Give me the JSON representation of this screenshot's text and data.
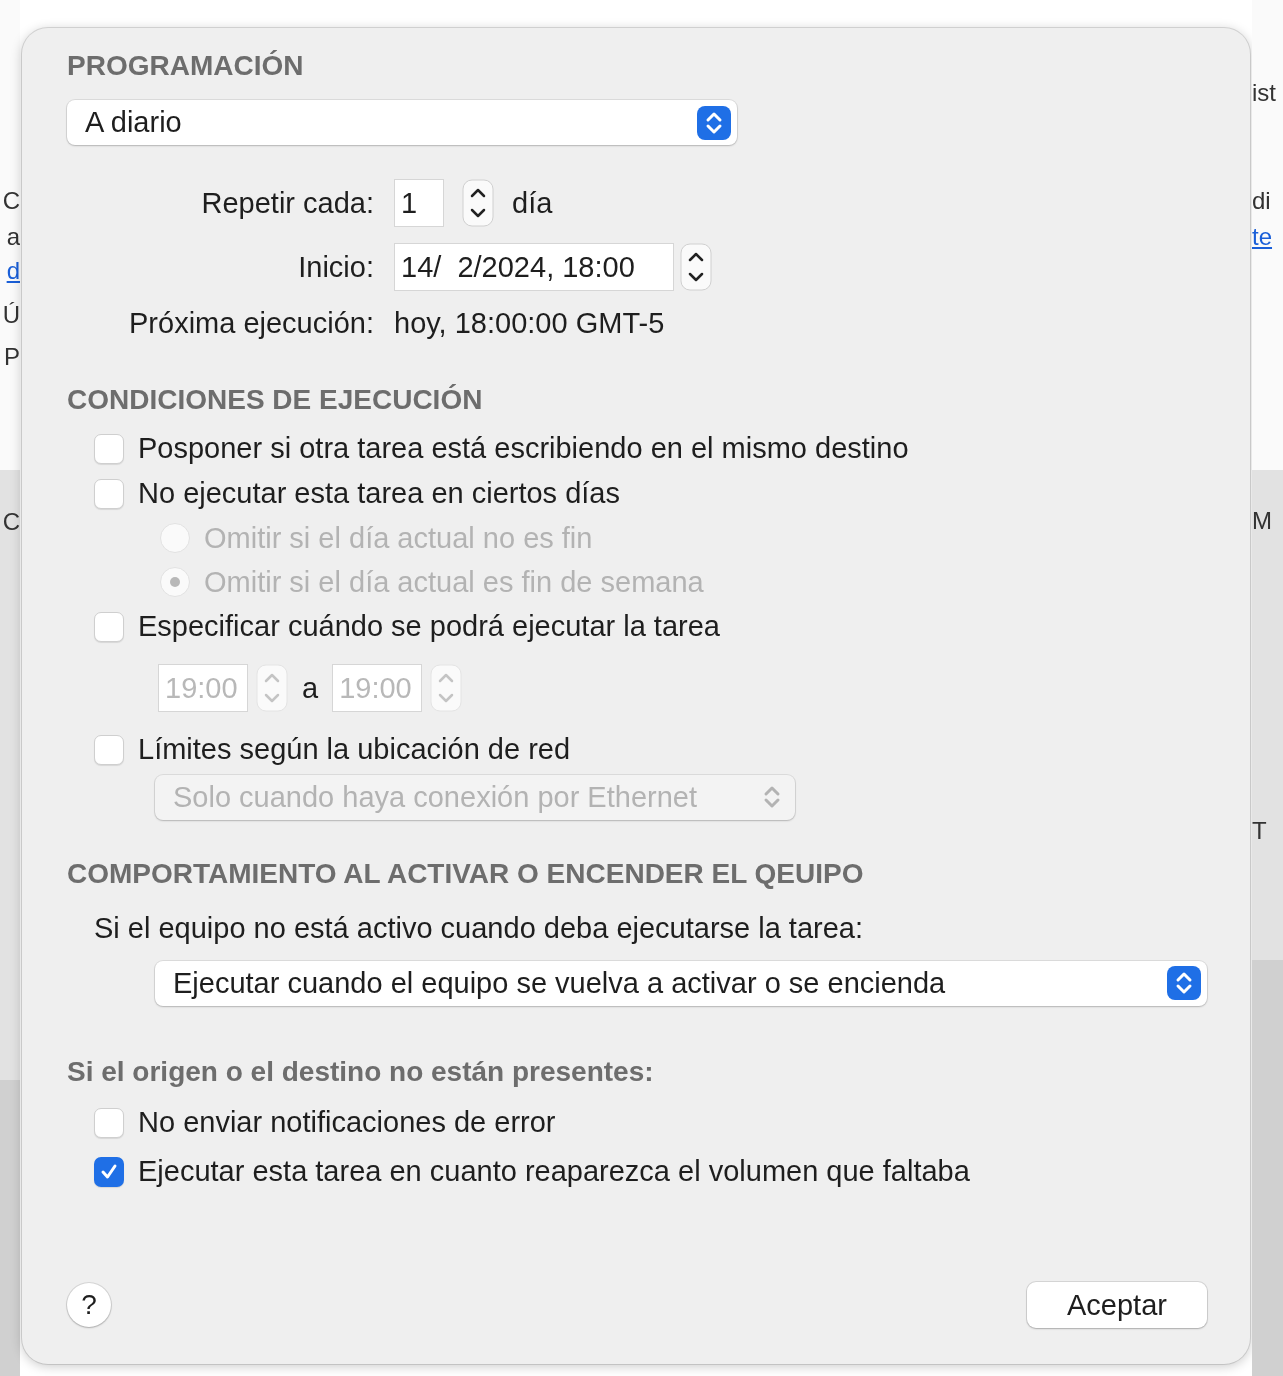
{
  "background": {
    "left_fragments": [
      {
        "kind": "text",
        "text": "C"
      },
      {
        "kind": "text",
        "text": "a"
      },
      {
        "kind": "link",
        "text": "d"
      },
      {
        "kind": "text",
        "text": "Ú"
      },
      {
        "kind": "text",
        "text": "P"
      },
      {
        "kind": "text",
        "text": "C"
      }
    ],
    "right_fragments": [
      {
        "kind": "text",
        "text": "ist"
      },
      {
        "kind": "text",
        "text": "di"
      },
      {
        "kind": "link",
        "text": "te"
      },
      {
        "kind": "text",
        "text": "M"
      },
      {
        "kind": "text",
        "text": "T"
      }
    ]
  },
  "schedule": {
    "heading": "PROGRAMACIÓN",
    "frequency": "A diario",
    "repeat_label": "Repetir cada:",
    "repeat_value": "1",
    "repeat_unit": "día",
    "start_label": "Inicio:",
    "start_value": "14/  2/2024, 18:00",
    "next_label": "Próxima ejecución:",
    "next_value": "hoy, 18:00:00 GMT-5"
  },
  "conditions": {
    "heading": "CONDICIONES DE EJECUCIÓN",
    "options": [
      {
        "kind": "checkbox",
        "label": "Posponer si otra tarea está escribiendo en el mismo destino",
        "checked": false,
        "disabled": false
      },
      {
        "kind": "checkbox",
        "label": "No ejecutar esta tarea en ciertos días",
        "checked": false,
        "disabled": false
      },
      {
        "kind": "radio",
        "label": "Omitir si el día actual no es fin",
        "selected": false,
        "disabled": true
      },
      {
        "kind": "radio",
        "label": "Omitir si el día actual es fin de semana",
        "selected": true,
        "disabled": true
      },
      {
        "kind": "checkbox",
        "label": "Especificar cuándo se podrá ejecutar la tarea",
        "checked": false,
        "disabled": false
      },
      {
        "kind": "time_range",
        "from": "19:00",
        "separator": "a",
        "to": "19:00",
        "disabled": true
      },
      {
        "kind": "checkbox",
        "label": "Límites según la ubicación de red",
        "checked": false,
        "disabled": false
      },
      {
        "kind": "select",
        "value": "Solo cuando haya conexión por Ethernet",
        "disabled": true
      }
    ]
  },
  "wake": {
    "heading": "COMPORTAMIENTO AL ACTIVAR O ENCENDER EL QEUIPO",
    "prompt": "Si el equipo no está activo cuando deba ejecutarse la tarea:",
    "action": "Ejecutar cuando el equipo se vuelva a activar o se encienda"
  },
  "missing": {
    "heading": "Si el origen o el destino no están presentes:",
    "options": [
      {
        "label": "No enviar notificaciones de error",
        "checked": false
      },
      {
        "label": "Ejecutar esta tarea en cuanto reaparezca el volumen que faltaba",
        "checked": true
      }
    ]
  },
  "footer": {
    "help": "?",
    "accept": "Aceptar"
  }
}
